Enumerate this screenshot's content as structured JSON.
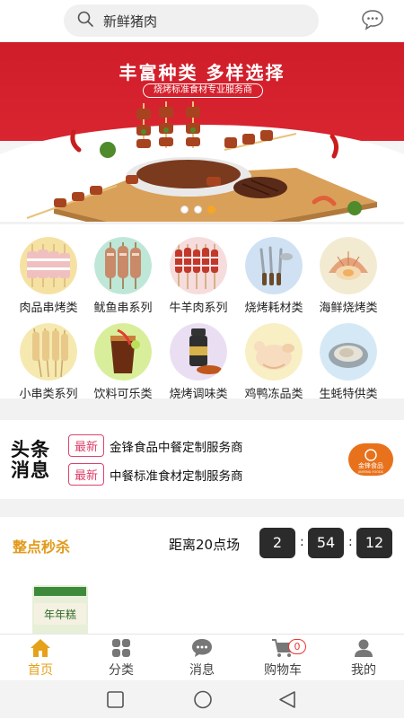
{
  "search": {
    "placeholder": "新鲜猪肉"
  },
  "banner": {
    "headline": "丰富种类  多样选择",
    "subline": "烧烤标准食材专业服务商",
    "slide_count": 3,
    "active_slide": 3
  },
  "categories": [
    {
      "label": "肉品串烤类",
      "icon": "pork-skewers-icon"
    },
    {
      "label": "鱿鱼串系列",
      "icon": "squid-skewers-icon"
    },
    {
      "label": "牛羊肉系列",
      "icon": "beef-lamb-skewers-icon"
    },
    {
      "label": "烧烤耗材类",
      "icon": "bbq-tools-icon"
    },
    {
      "label": "海鲜烧烤类",
      "icon": "scallop-icon"
    },
    {
      "label": "小串类系列",
      "icon": "small-skewers-icon"
    },
    {
      "label": "饮料可乐类",
      "icon": "cola-drink-icon"
    },
    {
      "label": "烧烤调味类",
      "icon": "seasoning-jar-icon"
    },
    {
      "label": "鸡鸭冻品类",
      "icon": "frozen-chicken-icon"
    },
    {
      "label": "生蚝特供类",
      "icon": "oyster-icon"
    }
  ],
  "headlines": {
    "title_line1": "头条",
    "title_line2": "消息",
    "items": [
      {
        "tag": "最新",
        "text": "金锋食品中餐定制服务商"
      },
      {
        "tag": "最新",
        "text": "中餐标准食材定制服务商"
      }
    ],
    "logo_text": "金锋食品",
    "logo_sub": "JINFENG FOODS"
  },
  "flash_sale": {
    "title": "整点秒杀",
    "countdown_label": "距离20点场",
    "hours": "2",
    "minutes": "54",
    "seconds": "12",
    "product_label": "年年糕"
  },
  "tabbar": {
    "items": [
      {
        "label": "首页",
        "icon": "home-icon",
        "active": true
      },
      {
        "label": "分类",
        "icon": "grid-icon",
        "active": false
      },
      {
        "label": "消息",
        "icon": "chat-icon",
        "active": false
      },
      {
        "label": "购物车",
        "icon": "cart-icon",
        "active": false
      },
      {
        "label": "我的",
        "icon": "user-icon",
        "active": false
      }
    ],
    "cart_badge": "0"
  },
  "colors": {
    "accent": "#e6a11b",
    "banner_red": "#d92530",
    "tag_pink": "#e0406b"
  }
}
